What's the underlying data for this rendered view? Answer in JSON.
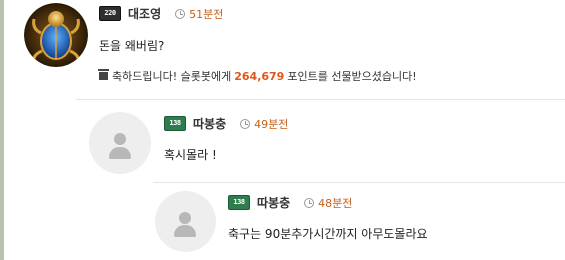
{
  "comments": [
    {
      "level": "220",
      "nickname": "대조영",
      "time": "51분전",
      "text": "돈을 왜버림?",
      "gift": {
        "before": "축하드립니다! 슬롯봇에게",
        "points": "264,679",
        "after": "포인트를 선물받으셨습니다!"
      }
    },
    {
      "level": "138",
      "nickname": "따봉충",
      "time": "49분전",
      "text": "혹시몰라 !"
    },
    {
      "level": "138",
      "nickname": "따봉충",
      "time": "48분전",
      "text": "축구는 90분추가시간까지 아무도몰라요"
    }
  ],
  "icons": {
    "avatar_main": "scarab-beetle-avatar",
    "avatar_default": "default-user-avatar",
    "clock": "clock-icon",
    "gift": "gift-icon"
  },
  "colors": {
    "time": "#c2621d",
    "points": "#e0561b",
    "level_badge_1": "#2e2e2e",
    "level_badge_2": "#2f7d4f"
  }
}
